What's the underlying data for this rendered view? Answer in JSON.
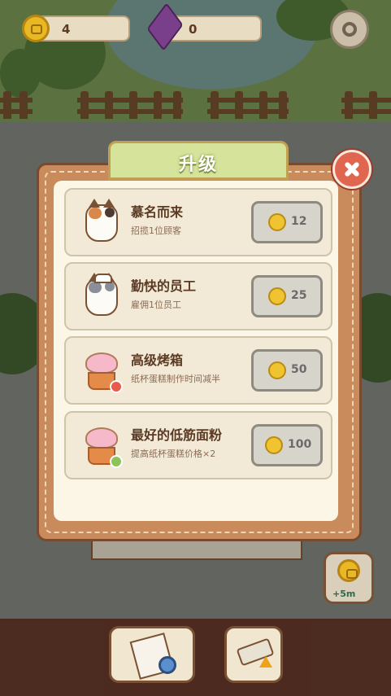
{
  "hud": {
    "coins": "4",
    "gems": "0",
    "icons": {
      "coin": "cat-coin-icon",
      "gem": "purple-gem-icon",
      "settings": "gear-icon"
    }
  },
  "dialog": {
    "title": "升级",
    "close_icon": "close-icon",
    "items": [
      {
        "name": "慕名而来",
        "desc": "招揽1位顾客",
        "price": "12",
        "icon": "calico-cat-icon"
      },
      {
        "name": "勤快的员工",
        "desc": "雇佣1位员工",
        "price": "25",
        "icon": "chef-cat-icon"
      },
      {
        "name": "高级烤箱",
        "desc": "纸杯蛋糕制作时间减半",
        "price": "50",
        "icon": "cupcake-timer-icon"
      },
      {
        "name": "最好的低筋面粉",
        "desc": "提高纸杯蛋糕价格×2",
        "price": "100",
        "icon": "cupcake-plus-icon"
      }
    ]
  },
  "side_button": {
    "label": "+5m",
    "icon": "coin-boost-icon"
  },
  "bottom": {
    "icons": [
      "newspaper-search-icon",
      "paint-roller-icon"
    ]
  },
  "colors": {
    "close": "#e06650",
    "title_tab": "#d6e39a",
    "dialog_frame": "#c98a5c"
  }
}
